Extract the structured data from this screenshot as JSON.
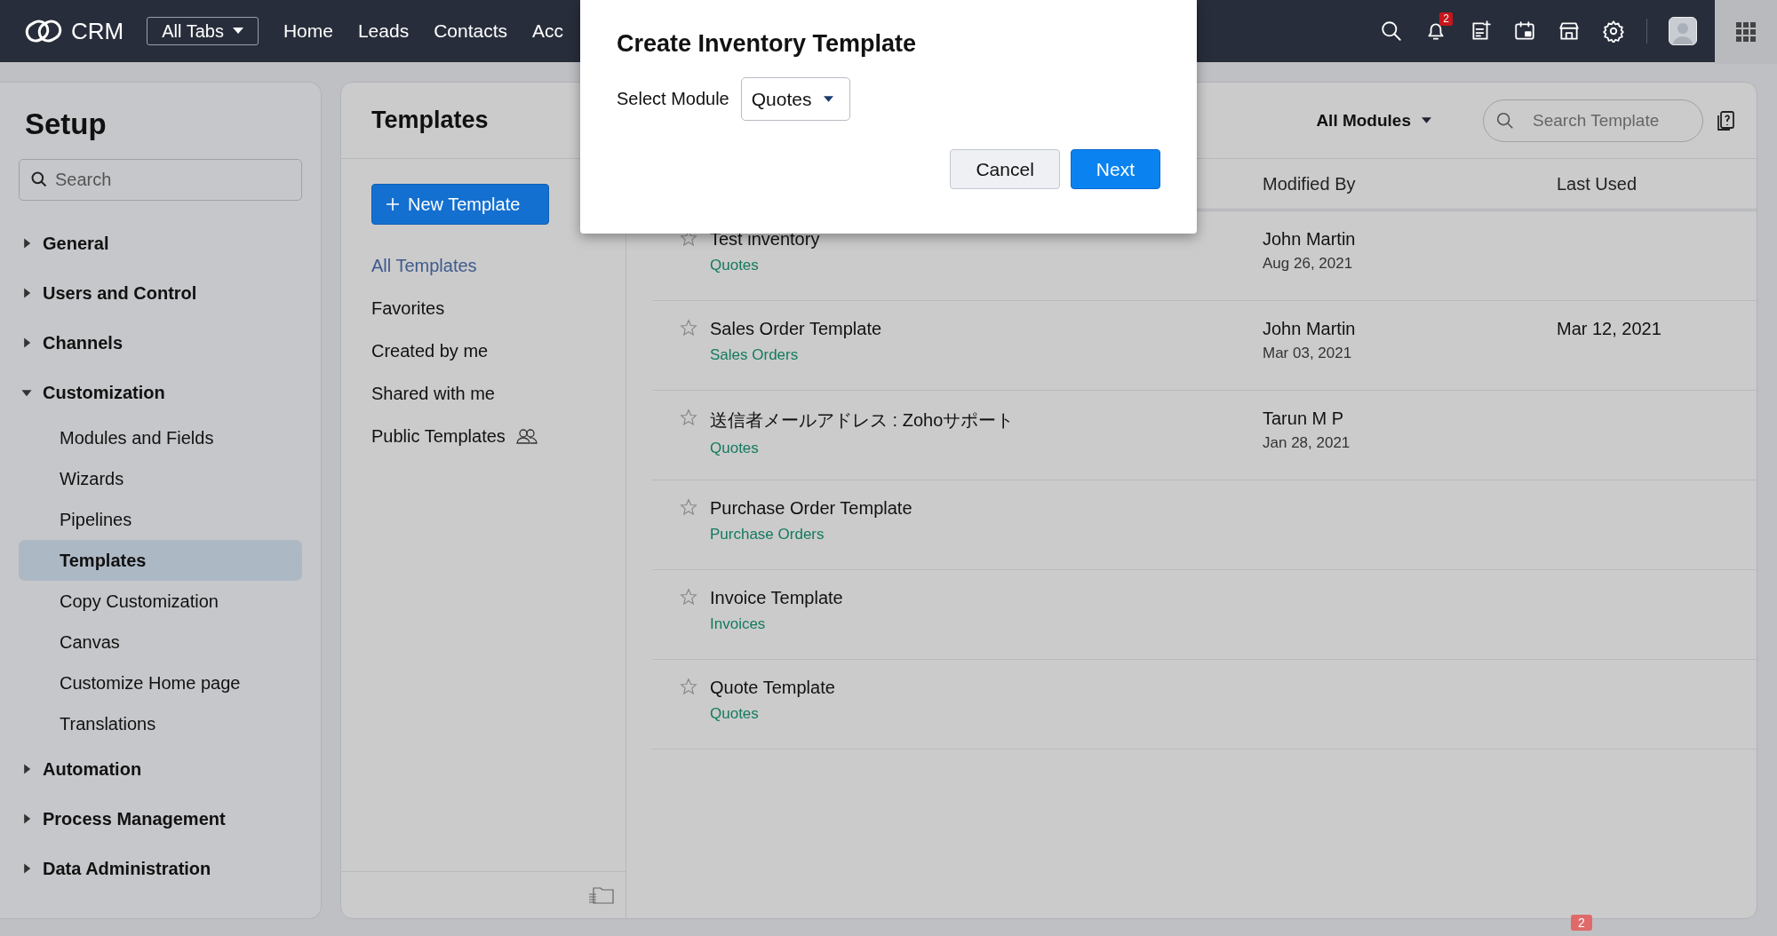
{
  "topbar": {
    "app_name": "CRM",
    "tabs_menu": "All Tabs",
    "nav": [
      "Home",
      "Leads",
      "Contacts",
      "Acc"
    ],
    "notification_count": "2"
  },
  "sidebar": {
    "title": "Setup",
    "search": {
      "placeholder": "Search"
    },
    "items": [
      {
        "label": "General",
        "expanded": false
      },
      {
        "label": "Users and Control",
        "expanded": false
      },
      {
        "label": "Channels",
        "expanded": false
      },
      {
        "label": "Customization",
        "expanded": true,
        "children": [
          {
            "label": "Modules and Fields",
            "selected": false
          },
          {
            "label": "Wizards",
            "selected": false
          },
          {
            "label": "Pipelines",
            "selected": false
          },
          {
            "label": "Templates",
            "selected": true
          },
          {
            "label": "Copy Customization",
            "selected": false
          },
          {
            "label": "Canvas",
            "selected": false
          },
          {
            "label": "Customize Home page",
            "selected": false
          },
          {
            "label": "Translations",
            "selected": false
          }
        ]
      },
      {
        "label": "Automation",
        "expanded": false
      },
      {
        "label": "Process Management",
        "expanded": false
      },
      {
        "label": "Data Administration",
        "expanded": false
      }
    ]
  },
  "templates": {
    "title": "Templates",
    "new_button": "New Template",
    "filters": [
      {
        "label": "All Templates",
        "selected": true,
        "public": false
      },
      {
        "label": "Favorites",
        "selected": false,
        "public": false
      },
      {
        "label": "Created by me",
        "selected": false,
        "public": false
      },
      {
        "label": "Shared with me",
        "selected": false,
        "public": false
      },
      {
        "label": "Public Templates",
        "selected": false,
        "public": true
      }
    ],
    "module_filter": "All Modules",
    "search": {
      "placeholder": "Search Template"
    },
    "table": {
      "columns": [
        "Modified By",
        "Last Used"
      ],
      "rows": [
        {
          "name": "Test inventory",
          "module": "Quotes",
          "favorite": false,
          "modified_by": "John Martin",
          "modified_on": "Aug 26, 2021"
        },
        {
          "name": "Sales Order Template",
          "module": "Sales Orders",
          "favorite": false,
          "modified_by": "John Martin",
          "modified_on": "Mar 03, 2021",
          "last_used": "Mar 12, 2021"
        },
        {
          "name": "送信者メールアドレス : Zohoサポート",
          "module": "Quotes",
          "favorite": false,
          "modified_by": "Tarun M P",
          "modified_on": "Jan 28, 2021"
        },
        {
          "name": "Purchase Order Template",
          "module": "Purchase Orders",
          "favorite": false
        },
        {
          "name": "Invoice Template",
          "module": "Invoices",
          "favorite": false
        },
        {
          "name": "Quote Template",
          "module": "Quotes",
          "favorite": false
        }
      ]
    }
  },
  "dialog": {
    "title": "Create Inventory Template",
    "field_label": "Select Module",
    "value": "Quotes",
    "buttons": [
      {
        "label": "Cancel",
        "kind": "secondary"
      },
      {
        "label": "Next",
        "kind": "primary"
      }
    ]
  },
  "footer_badge": "2"
}
